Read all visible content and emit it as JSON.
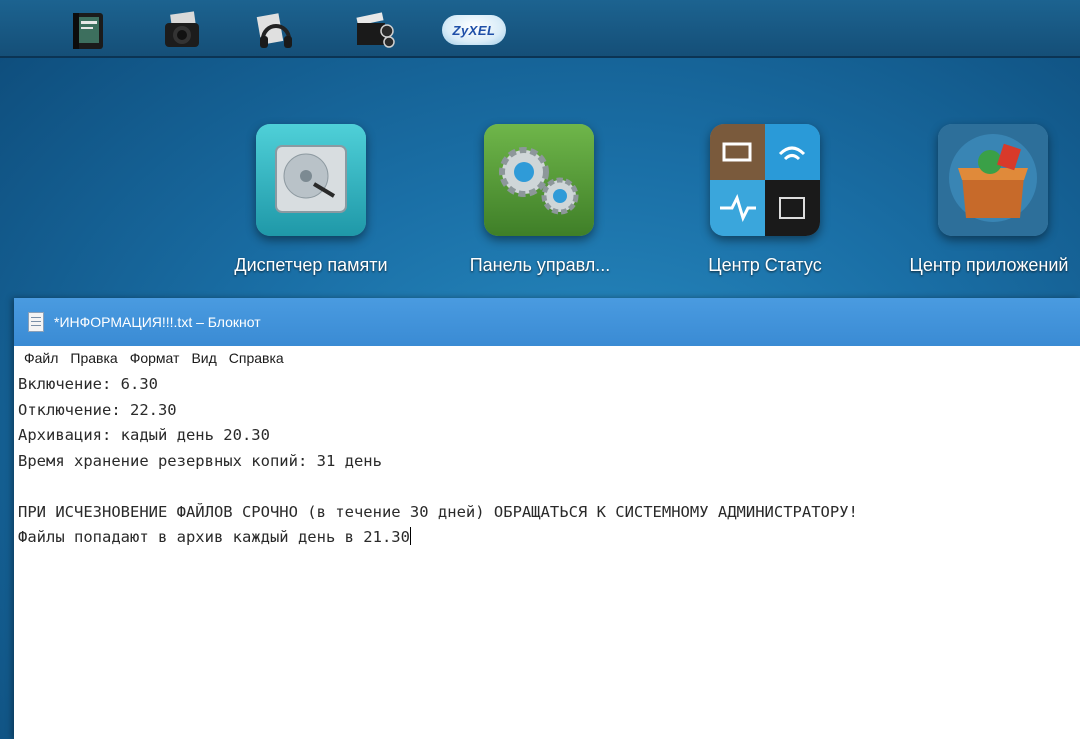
{
  "dock": {
    "items": [
      {
        "name": "notebook-app-icon"
      },
      {
        "name": "camera-app-icon"
      },
      {
        "name": "headphones-app-icon"
      },
      {
        "name": "video-app-icon"
      },
      {
        "name": "zyxel-cloud-icon",
        "label": "ZyXEL"
      }
    ]
  },
  "apps": [
    {
      "label": "Диспетчер памяти",
      "icon": "hard-drive-icon"
    },
    {
      "label": "Панель управл...",
      "icon": "gears-icon"
    },
    {
      "label": "Центр Статус",
      "icon": "status-grid-icon"
    },
    {
      "label": "Центр приложений",
      "icon": "app-box-icon"
    }
  ],
  "notepad": {
    "title": "*ИНФОРМАЦИЯ!!!.txt – Блокнот",
    "menu": [
      "Файл",
      "Правка",
      "Формат",
      "Вид",
      "Справка"
    ],
    "lines": [
      "Включение: 6.30",
      "Отключение: 22.30",
      "Архивация: кадый день 20.30",
      "Время хранение резервных копий: 31 день",
      "",
      "ПРИ ИСЧЕЗНОВЕНИЕ ФАЙЛОВ СРОЧНО (в течение 30 дней) ОБРАЩАТЬСЯ К СИСТЕМНОМУ АДМИНИСТРАТОРУ!",
      "Файлы попадают в архив каждый день в 21.30"
    ]
  },
  "colors": {
    "desktop": "#1a6fa6",
    "titlebar": "#3a8bd4"
  }
}
